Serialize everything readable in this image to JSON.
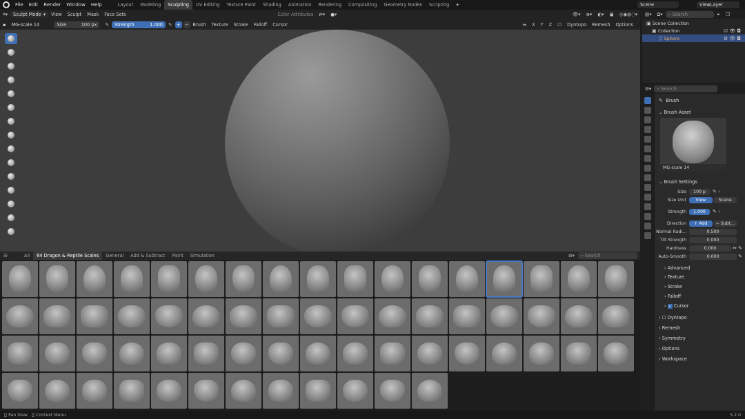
{
  "menu": [
    "File",
    "Edit",
    "Render",
    "Window",
    "Help"
  ],
  "workspaces": [
    "Layout",
    "Modeling",
    "Sculpting",
    "UV Editing",
    "Texture Paint",
    "Shading",
    "Animation",
    "Rendering",
    "Compositing",
    "Geometry Nodes",
    "Scripting"
  ],
  "active_workspace": "Sculpting",
  "scene": "Scene",
  "view_layer": "ViewLayer",
  "header1": {
    "mode": "Sculpt Mode",
    "items": [
      "View",
      "Sculpt",
      "Mask",
      "Face Sets"
    ],
    "color_attr": "Color Attributes"
  },
  "header2": {
    "brush": "MG-scale 14",
    "size_label": "Size",
    "size_value": "100 px",
    "strength_label": "Strength",
    "strength_value": "1.000",
    "menus": [
      "Brush",
      "Texture",
      "Stroke",
      "Falloff",
      "Cursor"
    ],
    "axes": [
      "X",
      "Y",
      "Z"
    ],
    "dyntopo": "Dyntopo",
    "remesh": "Remesh",
    "options": "Options"
  },
  "asset_tabs": [
    "All",
    "64 Dragon & Reptile Scales",
    "General",
    "Add & Subtract",
    "Paint",
    "Simulation"
  ],
  "asset_search": "Search",
  "outliner": {
    "search": "Search",
    "collection_root": "Scene Collection",
    "collection": "Collection",
    "object": "Sphere"
  },
  "props": {
    "search": "Search",
    "brush_title": "Brush",
    "brush_asset": "Brush Asset",
    "brush_name": "MG-scale 14",
    "brush_settings": "Brush Settings",
    "size_label": "Size",
    "size_value": "100 p",
    "size_unit_label": "Size Unit",
    "unit_view": "View",
    "unit_scene": "Scene",
    "strength_label": "Strength",
    "strength_value": "1.000",
    "direction_label": "Direction",
    "dir_add": "+ Add",
    "dir_sub": "− Subt...",
    "normal_label": "Normal Radi...",
    "normal_value": "0.500",
    "tilt_label": "Tilt Strength",
    "tilt_value": "0.000",
    "hardness_label": "Hardness",
    "hardness_value": "0.000",
    "autosmooth_label": "Auto-Smooth",
    "autosmooth_value": "0.000",
    "subsections": [
      "Advanced",
      "Texture",
      "Stroke",
      "Falloff",
      "Cursor"
    ],
    "panels": [
      "Dyntopo",
      "Remesh",
      "Symmetry",
      "Options",
      "Workspace"
    ]
  },
  "status": {
    "pan": "Pan View",
    "context": "Context Menu",
    "version": "5.2.0"
  }
}
